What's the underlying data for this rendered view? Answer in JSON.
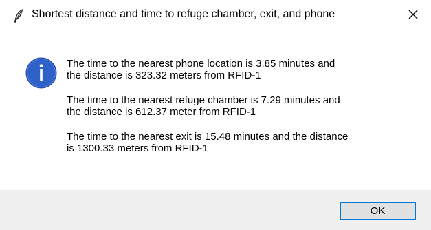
{
  "window": {
    "title": "Shortest distance and time to refuge chamber, exit, and phone",
    "app_icon": "feather-icon",
    "close_icon": "close-icon"
  },
  "message": {
    "icon": "info-icon",
    "paragraphs": [
      {
        "line1": "The time to the nearest phone location is 3.85 minutes and",
        "line2": "the distance is 323.32 meters from RFID-1"
      },
      {
        "line1": "The time to the nearest refuge chamber is 7.29 minutes and",
        "line2": "the distance is 612.37 meter from RFID-1"
      },
      {
        "line1": "The time to the nearest exit is 15.48 minutes and the distance",
        "line2": "is 1300.33 meters from RFID-1"
      }
    ]
  },
  "buttons": {
    "ok_label": "OK"
  },
  "colors": {
    "info_icon": "#2f62c9",
    "button_border": "#0078d7",
    "button_bar": "#f0f0f0"
  }
}
